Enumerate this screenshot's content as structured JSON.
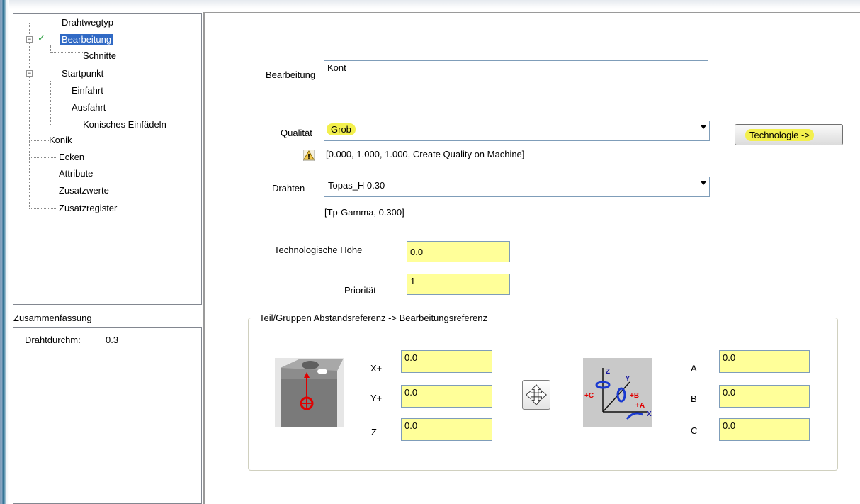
{
  "tree": {
    "items": [
      {
        "label": "Drahtwegtyp"
      },
      {
        "label": "Bearbeitung",
        "selected": true,
        "checked": true
      },
      {
        "label": "Schnitte"
      },
      {
        "label": "Startpunkt"
      },
      {
        "label": "Einfahrt"
      },
      {
        "label": "Ausfahrt"
      },
      {
        "label": "Konisches Einfädeln"
      },
      {
        "label": "Konik"
      },
      {
        "label": "Ecken"
      },
      {
        "label": "Attribute"
      },
      {
        "label": "Zusatzwerte"
      },
      {
        "label": "Zusatzregister"
      }
    ]
  },
  "summary": {
    "title": "Zusammenfassung",
    "row_label": "Drahtdurchm:",
    "row_value": "0.3"
  },
  "form": {
    "bearbeitung_label": "Bearbeitung",
    "bearbeitung_value": "Kont",
    "qualitaet_label": "Qualität",
    "qualitaet_value": "Grob",
    "qualitaet_info": "[0.000, 1.000, 1.000, Create Quality on Machine]",
    "technologie_button": "Technologie ->",
    "drahten_label": "Drahten",
    "drahten_value": "Topas_H 0.30",
    "drahten_info": "[Tp-Gamma, 0.300]",
    "tech_hoehe_label": "Technologische Höhe",
    "tech_hoehe_value": "0.0",
    "prioritaet_label": "Priorität",
    "prioritaet_value": "1"
  },
  "reference": {
    "title": "Teil/Gruppen Abstandsreferenz -> Bearbeitungsreferenz",
    "x_label": "X+",
    "x_value": "0.0",
    "y_label": "Y+",
    "y_value": "0.0",
    "z_label": "Z",
    "z_value": "0.0",
    "a_label": "A",
    "a_value": "0.0",
    "b_label": "B",
    "b_value": "0.0",
    "c_label": "C",
    "c_value": "0.0",
    "axis_icon_labels": {
      "z": "Z",
      "y": "Y",
      "c": "+C",
      "b": "+B",
      "a": "+A",
      "x": "X"
    }
  },
  "colors": {
    "highlight_yellow": "#f3f04e",
    "field_yellow": "#ffff99",
    "selection_blue": "#316ac5",
    "check_green": "#2ea043"
  }
}
